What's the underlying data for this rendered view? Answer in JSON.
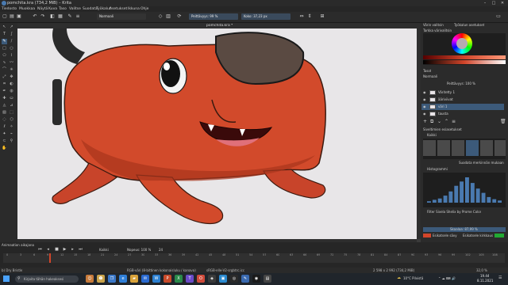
{
  "window": {
    "title": "pomchita.kra (734,2 MiB) – Krita",
    "controls": [
      "–",
      "□",
      "✕"
    ]
  },
  "menu": [
    "Tiedosto",
    "Muokkaa",
    "Näytä",
    "Kuva",
    "Taso",
    "Valitse",
    "Suodata",
    "Työkalut",
    "Asetukset",
    "Ikkuna",
    "Ohje"
  ],
  "toolbar": {
    "blend_mode": "Normaali",
    "opacity": "Peittävyys: 99 %",
    "size": "Koko: 37,23 px"
  },
  "document": {
    "tab": "pomchita.kra *"
  },
  "docker": {
    "color_tab": "Värin valitsin",
    "properties_tab": "Työkalun asetukset",
    "advanced_color": "Tarkka värivalitsin",
    "layers_title": "Tasot",
    "blend": "Normaali",
    "opacity": "Peittävyys: 100 %",
    "layers": [
      {
        "name": "Väritetty 1",
        "visible": "true"
      },
      {
        "name": "ääriviivat",
        "visible": "true"
      },
      {
        "name": "väri 1",
        "visible": "true",
        "selected": "true"
      },
      {
        "name": "tausta",
        "visible": "true"
      }
    ],
    "brush_presets_title": "Siveltimien esiasetukset",
    "brush_tag": "Kaikki",
    "brush_filter": "Suodata merkinnän mukaan",
    "histogram_title": "Histogrammi",
    "histogram_text": "Filter Sixela Shelix by Prome Color",
    "histogram_bars": [
      2,
      4,
      6,
      10,
      16,
      24,
      30,
      36,
      28,
      20,
      14,
      8,
      5,
      3
    ],
    "zoom_label": "Skaalaa: 87,99 %",
    "color_slider_a": "Esikatsele sävy",
    "color_slider_b": "Esikatsele kirkkaus",
    "accent": "#d2452a",
    "selected": "#3c5a7a"
  },
  "animation": {
    "title": "Animaation aikajana",
    "frame_mode": "Kaikki",
    "speed": "Nopeus: 100 %",
    "fps": "24",
    "ticks": [
      "0",
      "3",
      "6",
      "9",
      "12",
      "15",
      "18",
      "21",
      "24",
      "27",
      "30",
      "33",
      "36",
      "39",
      "42",
      "45",
      "48",
      "51",
      "54",
      "57",
      "60",
      "63",
      "66",
      "69",
      "72",
      "75",
      "78",
      "81",
      "84",
      "87",
      "90",
      "93",
      "96",
      "99",
      "102",
      "105",
      "108"
    ]
  },
  "status": {
    "brush": "b) Dry Bristle",
    "color_info": "RGB-väri (8-bittinen kokonaisluku / kanava)",
    "profile": "sRGB-elle-V2-srgbtrc.icc",
    "size": "2 598 x 2 992 (734,2 MiB)",
    "zoom": "32,0 %"
  },
  "taskbar": {
    "search": "Kirjoita tähän hakeaksesi",
    "weather": "10°C Pilvistä",
    "time": "19.44",
    "date": "8.11.2021"
  },
  "artwork": {
    "body_color": "#d24a2b",
    "shadow_color": "#a8341c",
    "eye_color": "#111111",
    "mouth_color": "#3a0a0a",
    "tongue_color": "#e0707a"
  }
}
